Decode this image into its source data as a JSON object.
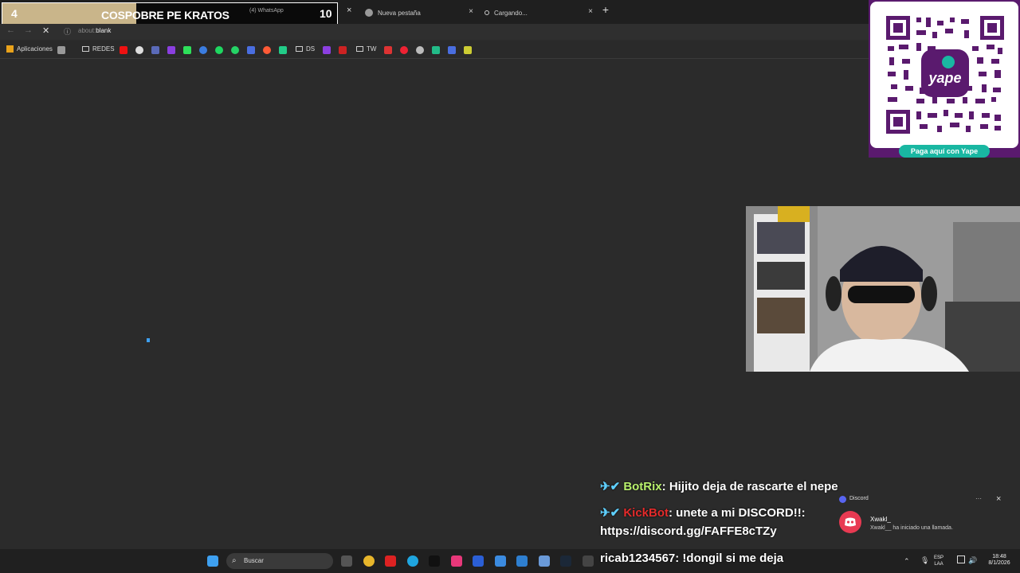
{
  "overlay": {
    "left_count": "4",
    "title": "COSPOBRE PE KRATOS",
    "right_count": "10",
    "behind_tab_label": "(4) WhatsApp"
  },
  "tabs": [
    {
      "label": "Nueva pestaña",
      "close": "×"
    },
    {
      "label": "Cargando...",
      "close": "×"
    }
  ],
  "active_tab_close": "×",
  "new_tab": "+",
  "address": {
    "scheme": "about:",
    "host": "blank"
  },
  "bookmarks": {
    "apps": "Aplicaciones",
    "redes": "REDES",
    "ds": "DS",
    "tw": "TW"
  },
  "qr": {
    "brand": "yape",
    "button": "Paga aquí con Yape"
  },
  "chat": [
    {
      "user": "BotRix",
      "text": "Hijito deja de rascarte el nepe"
    },
    {
      "user": "KickBot",
      "text": "unete a mi DISCORD!!:",
      "text2": "https://discord.gg/FAFFE8cTZy"
    },
    {
      "user": "ricab1234567",
      "text": "!dongil si me deja"
    }
  ],
  "toast": {
    "app": "Discord",
    "title": "Xwakl_",
    "message": "Xwakl__ ha iniciado una llamada.",
    "menu": "···",
    "close": "×"
  },
  "taskbar": {
    "search_placeholder": "Buscar",
    "lang_top": "ESP",
    "lang_bottom": "LAA",
    "time": "18:48",
    "date": "8/1/2026"
  },
  "colors": {
    "accent_yape": "#5a1a6e",
    "yape_button": "#19b7a2",
    "botrix": "#b8f06c",
    "kickbot": "#e52b2b"
  }
}
